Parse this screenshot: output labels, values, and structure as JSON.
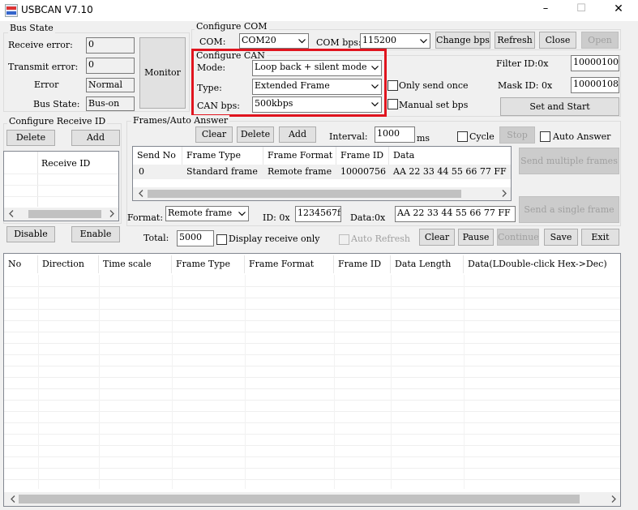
{
  "window": {
    "title": "USBCAN V7.10",
    "controls": {
      "minimize": "–",
      "maximize": "☐",
      "close": "✕"
    }
  },
  "bus_state": {
    "title": "Bus State",
    "receive_error_label": "Receive error:",
    "receive_error": "0",
    "transmit_error_label": "Transmit error:",
    "transmit_error": "0",
    "error_label": "Error",
    "error": "Normal",
    "bus_state_label": "Bus State:",
    "bus_state": "Bus-on",
    "monitor_button": "Monitor"
  },
  "configure_com": {
    "title": "Configure COM",
    "com_label": "COM:",
    "com_value": "COM20",
    "com_bps_label": "COM bps:",
    "com_bps_value": "115200",
    "change_bps_button": "Change bps",
    "refresh_button": "Refresh",
    "close_button": "Close",
    "open_button": "Open"
  },
  "configure_can": {
    "title": "Configure CAN",
    "mode_label": "Mode:",
    "mode_value": "Loop back + silent mode",
    "type_label": "Type:",
    "type_value": "Extended Frame",
    "can_bps_label": "CAN bps:",
    "can_bps_value": "500kbps",
    "only_send_once_label": "Only send once",
    "manual_set_bps_label": "Manual set bps",
    "filter_id_label": "Filter ID:0x",
    "filter_id_value": "10000100",
    "mask_id_label": "Mask ID:  0x",
    "mask_id_value": "10000108",
    "set_and_start_button": "Set and Start",
    "highlight_color": "#e0141e"
  },
  "receive_id": {
    "title": "Configure Receive ID",
    "delete_button": "Delete",
    "add_button": "Add",
    "column_header": "Receive ID",
    "disable_button": "Disable",
    "enable_button": "Enable"
  },
  "frames": {
    "title": "Frames/Auto Answer",
    "clear_button": "Clear",
    "delete_button": "Delete",
    "add_button": "Add",
    "interval_label": "Interval:",
    "interval_value": "1000",
    "interval_unit": "ms",
    "cycle_label": "Cycle",
    "stop_button": "Stop",
    "auto_answer_label": "Auto Answer",
    "columns": [
      "Send No",
      "Frame Type",
      "Frame Format",
      "Frame ID",
      "Data"
    ],
    "rows": [
      {
        "send_no": "0",
        "frame_type": "Standard frame",
        "frame_format": "Remote frame",
        "frame_id": "10000756",
        "data": "AA 22 33 44 55 66 77 FF"
      }
    ],
    "send_multiple_button": "Send multiple frames",
    "send_single_button": "Send a single frame"
  },
  "send_row": {
    "format_label": "Format:",
    "format_value": "Remote frame",
    "id_label": "ID: 0x",
    "id_value": "1234567f",
    "data_label": "Data:0x",
    "data_value": "AA 22 33 44 55 66 77 FF"
  },
  "receive_bar": {
    "total_label": "Total:",
    "total_value": "5000",
    "display_receive_only_label": "Display receive only",
    "auto_refresh_label": "Auto Refresh",
    "clear_button": "Clear",
    "pause_button": "Pause",
    "continue_button": "Continue",
    "save_button": "Save",
    "exit_button": "Exit"
  },
  "receive_table": {
    "columns": [
      "No",
      "Direction",
      "Time scale",
      "Frame Type",
      "Frame Format",
      "Frame ID",
      "Data Length",
      "Data(LDouble-click Hex->Dec)"
    ]
  },
  "icons": {
    "dropdown": "chevron-down-icon",
    "left": "arrow-left-icon",
    "right": "arrow-right-icon"
  }
}
